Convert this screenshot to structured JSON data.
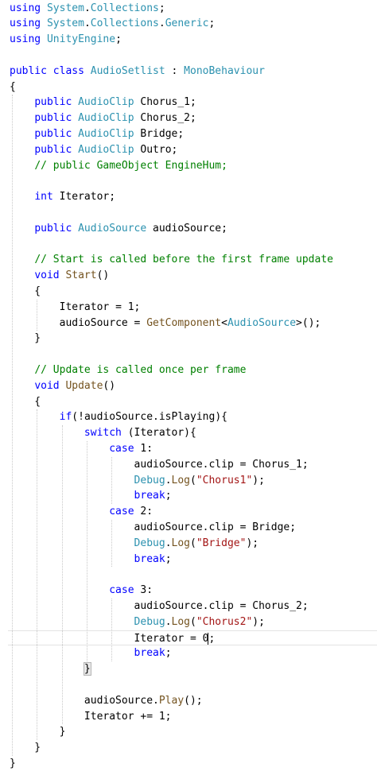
{
  "editor": {
    "language": "C#",
    "lines": [
      {
        "text": "using System.Collections;"
      },
      {
        "text": "using System.Collections.Generic;"
      },
      {
        "text": "using UnityEngine;"
      },
      {
        "text": ""
      },
      {
        "text": "public class AudioSetlist : MonoBehaviour"
      },
      {
        "text": "{"
      },
      {
        "text": "    public AudioClip Chorus_1;"
      },
      {
        "text": "    public AudioClip Chorus_2;"
      },
      {
        "text": "    public AudioClip Bridge;"
      },
      {
        "text": "    public AudioClip Outro;"
      },
      {
        "text": "    // public GameObject EngineHum;"
      },
      {
        "text": ""
      },
      {
        "text": "    int Iterator;"
      },
      {
        "text": ""
      },
      {
        "text": "    public AudioSource audioSource;"
      },
      {
        "text": ""
      },
      {
        "text": "    // Start is called before the first frame update"
      },
      {
        "text": "    void Start()"
      },
      {
        "text": "    {"
      },
      {
        "text": "        Iterator = 1;"
      },
      {
        "text": "        audioSource = GetComponent<AudioSource>();"
      },
      {
        "text": "    }"
      },
      {
        "text": ""
      },
      {
        "text": "    // Update is called once per frame"
      },
      {
        "text": "    void Update()"
      },
      {
        "text": "    {"
      },
      {
        "text": "        if(!audioSource.isPlaying){"
      },
      {
        "text": "            switch (Iterator){"
      },
      {
        "text": "                case 1:"
      },
      {
        "text": "                    audioSource.clip = Chorus_1;"
      },
      {
        "text": "                    Debug.Log(\"Chorus1\");"
      },
      {
        "text": "                    break;"
      },
      {
        "text": "                case 2:"
      },
      {
        "text": "                    audioSource.clip = Bridge;"
      },
      {
        "text": "                    Debug.Log(\"Bridge\");"
      },
      {
        "text": "                    break;"
      },
      {
        "text": ""
      },
      {
        "text": "                case 3:"
      },
      {
        "text": "                    audioSource.clip = Chorus_2;"
      },
      {
        "text": "                    Debug.Log(\"Chorus2\");"
      },
      {
        "text": "                    Iterator = 0;"
      },
      {
        "text": "                    break;"
      },
      {
        "text": "            }"
      },
      {
        "text": ""
      },
      {
        "text": "            audioSource.Play();"
      },
      {
        "text": "            Iterator += 1;"
      },
      {
        "text": "        }"
      },
      {
        "text": "    }"
      },
      {
        "text": "}"
      }
    ]
  },
  "colors": {
    "keyword": "#0000ff",
    "type": "#2b91af",
    "comment": "#008000",
    "string": "#a31515",
    "method": "#74531f",
    "text": "#000000",
    "background": "#ffffff"
  },
  "cursor": {
    "line": 41
  }
}
